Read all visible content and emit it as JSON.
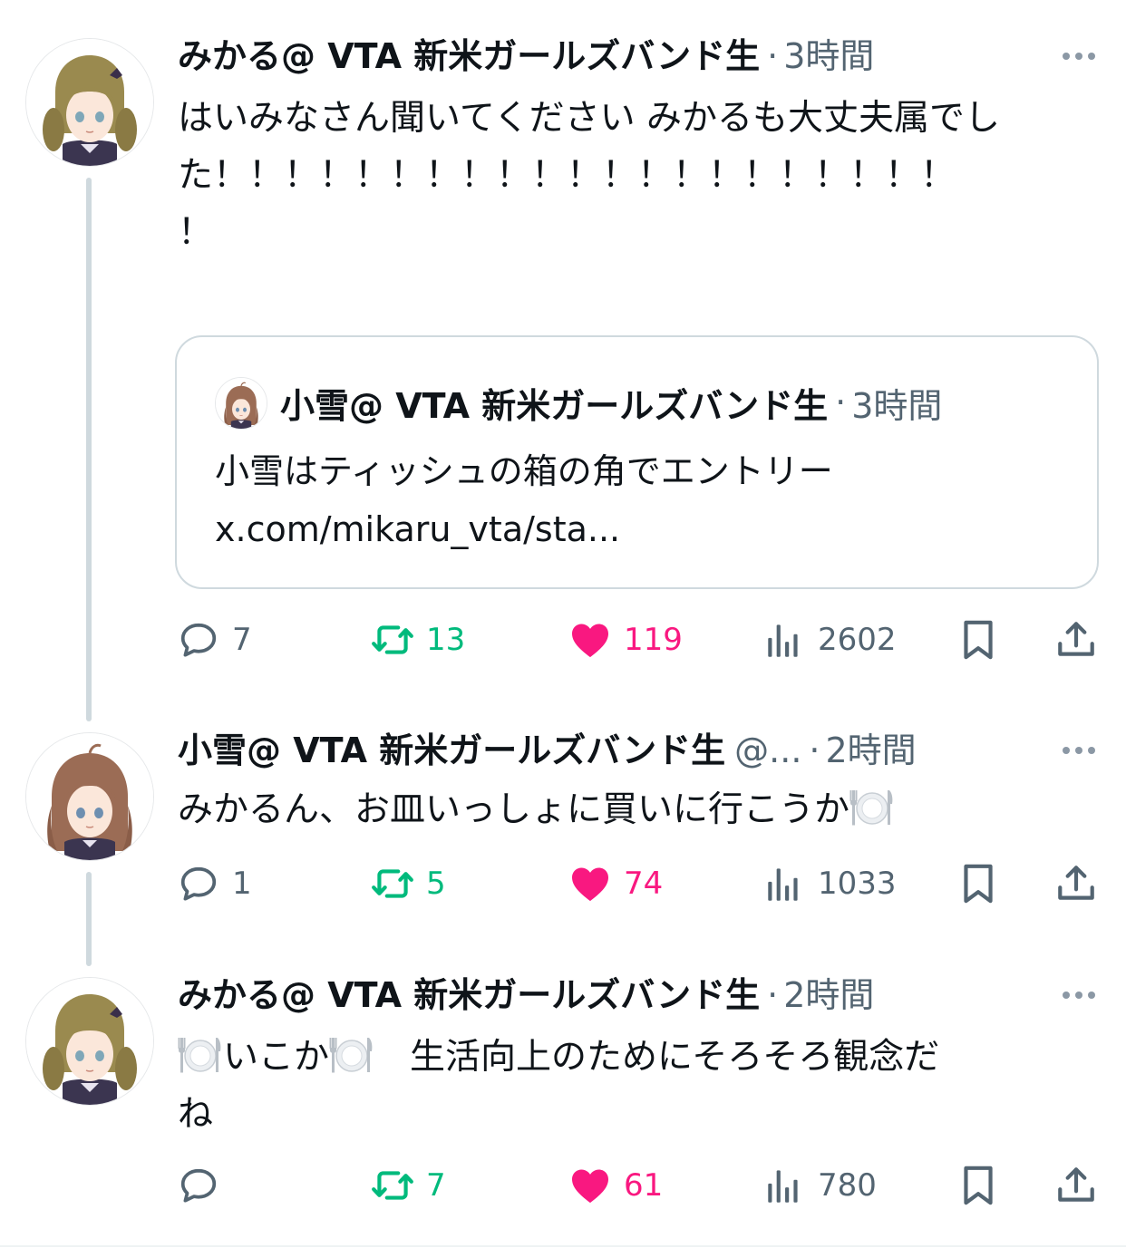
{
  "tweets": [
    {
      "name": "みかる@ VTA 新米ガールズバンド生",
      "handle": "",
      "separator": "·",
      "time": "3時間",
      "body_lines": [
        "はいみなさん聞いてください みかるも大丈夫属でし",
        "た！！！！！！！！！！！！！！！！！！！！！",
        "！"
      ],
      "quote": {
        "name": "小雪@ VTA 新米ガールズバンド生",
        "separator": "·",
        "time": "3時間",
        "text": "小雪はティッシュの箱の角でエントリー",
        "link": "x.com/mikaru_vta/sta..."
      },
      "replies": "7",
      "retweets": "13",
      "likes": "119",
      "views": "2602"
    },
    {
      "name": "小雪@ VTA 新米ガールズバンド生",
      "handle": "@...",
      "separator": "·",
      "time": "2時間",
      "body_text": "みかるん、お皿いっしょに買いに行こうか",
      "replies": "1",
      "retweets": "5",
      "likes": "74",
      "views": "1033"
    },
    {
      "name": "みかる@ VTA 新米ガールズバンド生",
      "handle": "",
      "separator": "·",
      "time": "2時間",
      "body_mid": "いこか",
      "body_rest": "　生活向上のためにそろそろ観念だ",
      "body_line2": "ね",
      "replies": "",
      "retweets": "7",
      "likes": "61",
      "views": "780"
    }
  ],
  "icons": {
    "reply": "reply-icon",
    "retweet": "retweet-icon",
    "like": "heart-icon",
    "views": "views-icon",
    "bookmark": "bookmark-icon",
    "share": "share-icon",
    "more": "more-icon",
    "plate": "plate-emoji"
  },
  "colors": {
    "text": "#0f1419",
    "secondary": "#536471",
    "retweet": "#00ba7c",
    "like": "#f91880",
    "border": "#cfd9de"
  }
}
